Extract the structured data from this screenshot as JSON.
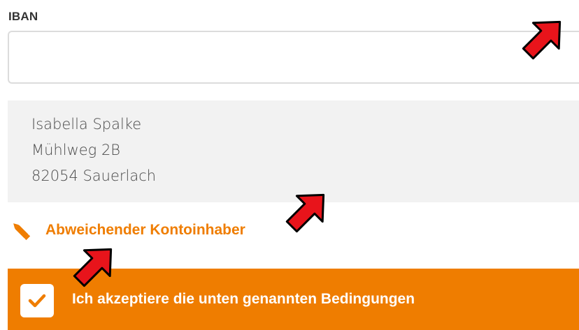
{
  "form": {
    "iban_label": "IBAN",
    "iban_value": "",
    "iban_placeholder": ""
  },
  "address": {
    "name": "Isabella Spalke",
    "street": "Mühlweg 2B",
    "city": "82054 Sauerlach"
  },
  "alternate_holder": {
    "label": "Abweichender Kontoinhaber",
    "icon": "pencil-icon"
  },
  "terms": {
    "label": "Ich akzeptiere die unten genannten Bedingungen",
    "checked": true
  },
  "colors": {
    "accent": "#ef7d00",
    "address_bg": "#f2f2f2",
    "annotation_arrow": "#e8141b"
  },
  "annotations": {
    "arrow_icon": "red-arrow-icon"
  }
}
